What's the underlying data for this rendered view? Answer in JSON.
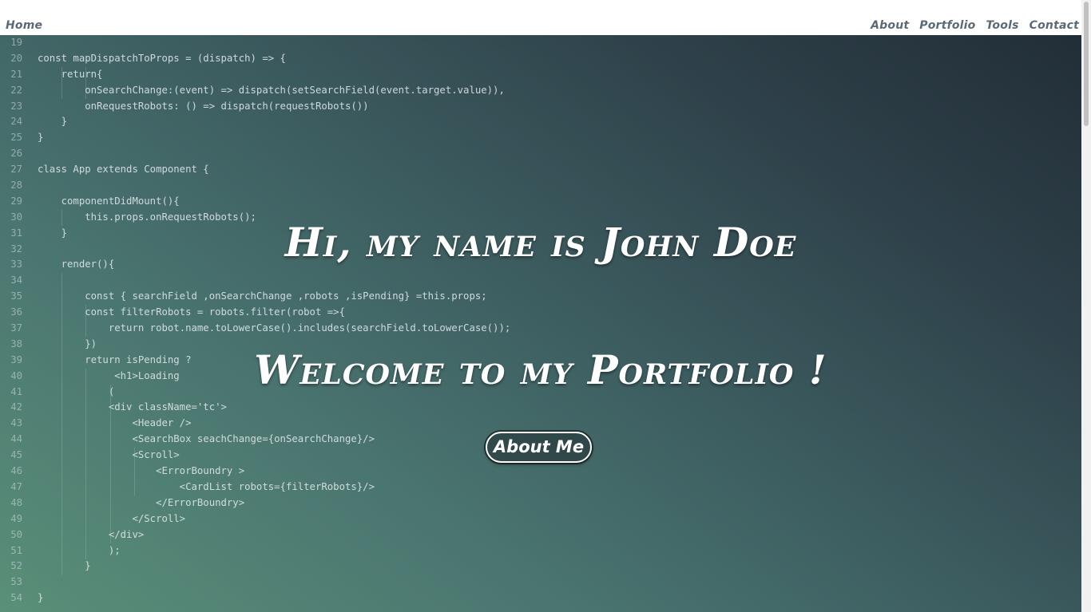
{
  "nav": {
    "home": "Home",
    "about": "About",
    "portfolio": "Portfolio",
    "tools": "Tools",
    "contact": "Contact"
  },
  "hero": {
    "headline": "Hi, my name is John Doe",
    "subheadline": "Welcome to my Portfolio !",
    "button_label": "About Me"
  },
  "code_lines": [
    {
      "n": "19",
      "text": ""
    },
    {
      "n": "20",
      "text": "const mapDispatchToProps = (dispatch) => {"
    },
    {
      "n": "21",
      "text": "    return{"
    },
    {
      "n": "22",
      "text": "        onSearchChange:(event) => dispatch(setSearchField(event.target.value)),"
    },
    {
      "n": "23",
      "text": "        onRequestRobots: () => dispatch(requestRobots())"
    },
    {
      "n": "24",
      "text": "    }"
    },
    {
      "n": "25",
      "text": "}"
    },
    {
      "n": "26",
      "text": ""
    },
    {
      "n": "27",
      "text": "class App extends Component {"
    },
    {
      "n": "28",
      "text": ""
    },
    {
      "n": "29",
      "text": "    componentDidMount(){"
    },
    {
      "n": "30",
      "text": "        this.props.onRequestRobots();"
    },
    {
      "n": "31",
      "text": "    }"
    },
    {
      "n": "32",
      "text": ""
    },
    {
      "n": "33",
      "text": "    render(){"
    },
    {
      "n": "34",
      "text": ""
    },
    {
      "n": "35",
      "text": "        const { searchField ,onSearchChange ,robots ,isPending} =this.props;"
    },
    {
      "n": "36",
      "text": "        const filterRobots = robots.filter(robot =>{"
    },
    {
      "n": "37",
      "text": "            return robot.name.toLowerCase().includes(searchField.toLowerCase());"
    },
    {
      "n": "38",
      "text": "        })"
    },
    {
      "n": "39",
      "text": "        return isPending ?"
    },
    {
      "n": "40",
      "text": "             <h1>Loading"
    },
    {
      "n": "41",
      "text": "            ("
    },
    {
      "n": "42",
      "text": "            <div className='tc'>"
    },
    {
      "n": "43",
      "text": "                <Header />"
    },
    {
      "n": "44",
      "text": "                <SearchBox seachChange={onSearchChange}/>"
    },
    {
      "n": "45",
      "text": "                <Scroll>"
    },
    {
      "n": "46",
      "text": "                    <ErrorBoundry >"
    },
    {
      "n": "47",
      "text": "                        <CardList robots={filterRobots}/>"
    },
    {
      "n": "48",
      "text": "                    </ErrorBoundry>"
    },
    {
      "n": "49",
      "text": "                </Scroll>"
    },
    {
      "n": "50",
      "text": "            </div>"
    },
    {
      "n": "51",
      "text": "            );"
    },
    {
      "n": "52",
      "text": "        }"
    },
    {
      "n": "53",
      "text": ""
    },
    {
      "n": "54",
      "text": "}"
    }
  ]
}
